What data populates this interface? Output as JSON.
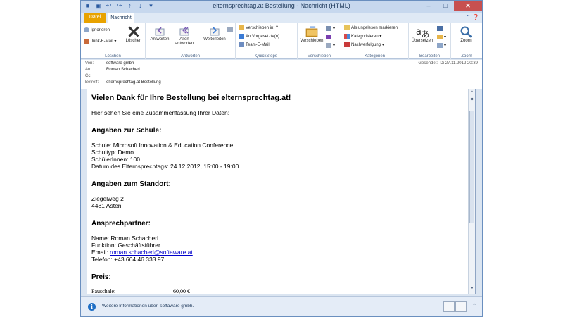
{
  "window": {
    "title": "elternsprechtag.at Bestellung - Nachricht (HTML)",
    "minimize": "–",
    "maximize": "□",
    "close": "✕"
  },
  "tabs": [
    {
      "label": "Datei"
    },
    {
      "label": "Nachricht"
    }
  ],
  "ribbon": {
    "loeschen": {
      "group_label": "Löschen",
      "ignore": "Ignorieren",
      "junk": "Junk-E-Mail ▾",
      "delete": "Löschen"
    },
    "antworten": {
      "group_label": "Antworten",
      "reply": "Antworten",
      "reply_all": "Allen antworten",
      "forward": "Weiterleiten"
    },
    "quicksteps": {
      "group_label": "QuickSteps",
      "items": [
        "Verschieben in: ?",
        "An Vorgesetzte(n)",
        "Team-E-Mail"
      ]
    },
    "verschieben": {
      "group_label": "Verschieben",
      "move": "Verschieben"
    },
    "kategorien": {
      "group_label": "Kategorien",
      "items": [
        "Als ungelesen markieren",
        "Kategorisieren ▾",
        "Nachverfolgung ▾"
      ]
    },
    "bearbeiten": {
      "group_label": "Bearbeiten",
      "translate": "Übersetzen"
    },
    "zoom": {
      "group_label": "Zoom",
      "zoom": "Zoom"
    }
  },
  "header": {
    "from_label": "Von:",
    "from": "software gmbh",
    "to_label": "An:",
    "to": "Roman Schacherl",
    "cc_label": "Cc:",
    "cc": "",
    "subject_label": "Betreff:",
    "subject": "elternsprechtag.at Bestellung",
    "sent_label": "Gesendet:",
    "sent": "Di 27.11.2012 20:39"
  },
  "body": {
    "heading": "Vielen Dank für Ihre Bestellung bei elternsprechtag.at!",
    "intro": "Hier sehen Sie eine Zusammenfassung Ihrer Daten:",
    "school_heading": "Angaben zur Schule:",
    "school_lines": [
      "Schule: Microsoft Innovation & Education Conference",
      "Schultyp: Demo",
      "SchülerInnen: 100",
      "Datum des Elternsprechtags: 24.12.2012, 15:00 - 19:00"
    ],
    "location_heading": "Angaben zum Standort:",
    "location_lines": [
      "Ziegelweg 2",
      "4481 Asten"
    ],
    "contact_heading": "Ansprechpartner:",
    "contact_name": "Name: Roman Schacherl",
    "contact_function": "Funktion: Geschäftsführer",
    "contact_email_label": "Email: ",
    "contact_email": "roman.schacherl@softaware.at",
    "contact_phone": "Telefon: +43 664 46 333 97",
    "price_heading": "Preis:",
    "price_label": "Pauschale:",
    "price_value": "60,00 €"
  },
  "status": {
    "info_text": "Weitere Informationen über: softaware gmbh."
  }
}
